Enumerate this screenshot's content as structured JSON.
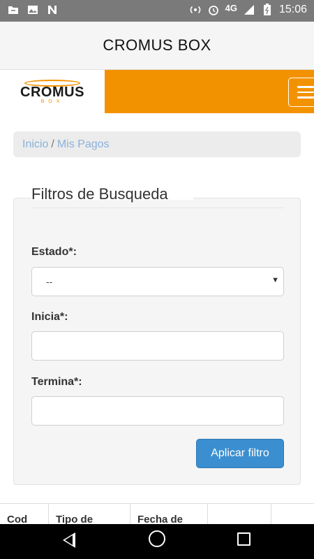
{
  "status_bar": {
    "network": "4G",
    "time": "15:06"
  },
  "app_bar": {
    "title": "CROMUS BOX"
  },
  "navbar": {
    "logo_text": "CROMUS",
    "logo_sub": "BOX",
    "menu_icon": "hamburger-icon"
  },
  "breadcrumb": {
    "home": "Inicio",
    "separator": "/",
    "current": "Mis Pagos"
  },
  "filters": {
    "title": "Filtros de Busqueda",
    "estado_label": "Estado*:",
    "estado_value": "--",
    "inicia_label": "Inicia*:",
    "inicia_value": "",
    "termina_label": "Termina*:",
    "termina_value": "",
    "apply_label": "Aplicar filtro"
  },
  "table": {
    "columns": [
      "Cod",
      "Tipo de",
      "Fecha de",
      "",
      ""
    ]
  },
  "colors": {
    "accent": "#f39200",
    "primary_button": "#3b8fd0",
    "link": "#8ab1da"
  }
}
